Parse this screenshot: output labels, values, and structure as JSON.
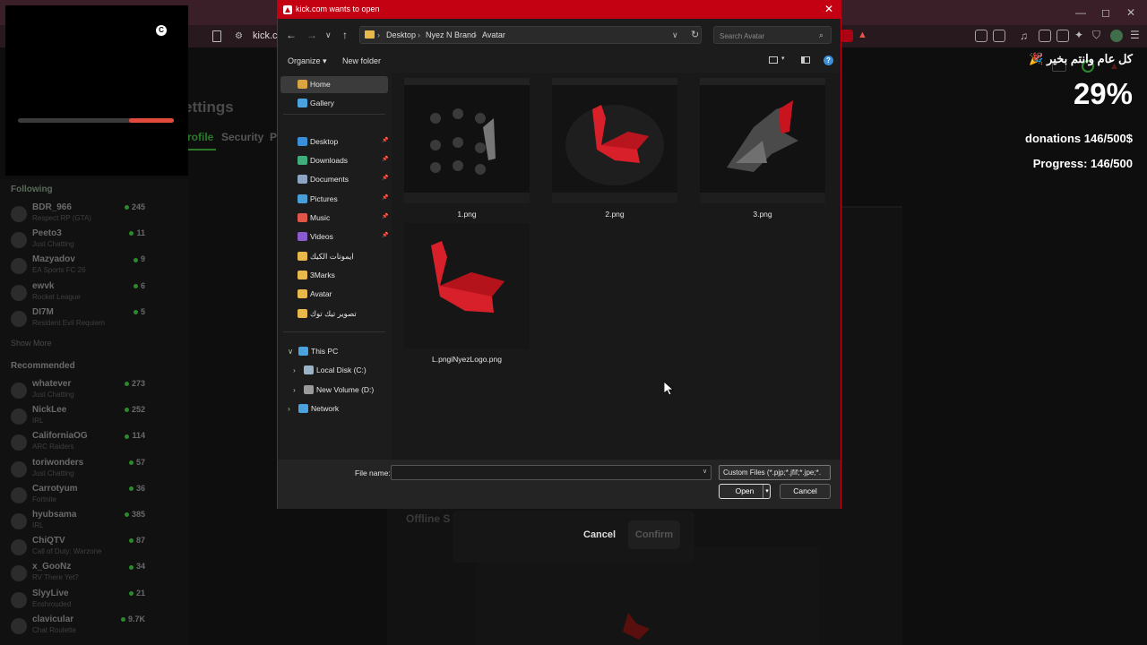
{
  "browser": {
    "url": "kick.cc",
    "window_controls": [
      "—",
      "◻",
      "✕"
    ]
  },
  "overlay": {
    "heading": "كل عام وانتم بخير 🎉",
    "percent": "29%",
    "progress_fraction": 0.29,
    "donations": "donations 146/500$",
    "progress": "Progress: 146/500"
  },
  "kick": {
    "page_title": "ettings",
    "tabs": [
      "rofile",
      "Security",
      "P"
    ],
    "following_title": "Following",
    "following": [
      {
        "name": "BDR_966",
        "game": "Respect RP (GTA)",
        "viewers": "245"
      },
      {
        "name": "Peeto3",
        "game": "Just Chatting",
        "viewers": "11"
      },
      {
        "name": "Mazyadov",
        "game": "EA Sports FC 26",
        "viewers": "9"
      },
      {
        "name": "ewvk",
        "game": "Rocket League",
        "viewers": "6"
      },
      {
        "name": "DI7M",
        "game": "Resident Evil Requiem",
        "viewers": "5"
      }
    ],
    "show_more": "Show More",
    "recommended_title": "Recommended",
    "recommended": [
      {
        "name": "whatever",
        "game": "Just Chatting",
        "viewers": "273"
      },
      {
        "name": "NickLee",
        "game": "IRL",
        "viewers": "252"
      },
      {
        "name": "CaliforniaOG",
        "game": "ARC Raiders",
        "viewers": "114"
      },
      {
        "name": "toriwonders",
        "game": "Just Chatting",
        "viewers": "57"
      },
      {
        "name": "Carrotyum",
        "game": "Fortnite",
        "viewers": "36"
      },
      {
        "name": "hyubsama",
        "game": "IRL",
        "viewers": "385"
      },
      {
        "name": "ChiQTV",
        "game": "Call of Duty: Warzone",
        "viewers": "87"
      },
      {
        "name": "x_GooNz",
        "game": "RV There Yet?",
        "viewers": "34"
      },
      {
        "name": "SlyyLive",
        "game": "Enshrouded",
        "viewers": "21"
      },
      {
        "name": "clavicular",
        "game": "Chat Roulette",
        "viewers": "9.7K"
      }
    ],
    "offline_label": "Offline S",
    "cancel": "Cancel",
    "confirm": "Confirm"
  },
  "dialog": {
    "title": "kick.com wants to open",
    "close": "✕",
    "breadcrumb": [
      "Desktop",
      "Nyez N Brand",
      "Avatar"
    ],
    "search_placeholder": "Search Avatar",
    "organize": "Organize ▾",
    "new_folder": "New folder",
    "nav_items": [
      {
        "label": "Home",
        "icon": "home-icon",
        "color": "#d9a441",
        "selected": true,
        "pin": false
      },
      {
        "label": "Gallery",
        "icon": "gallery-icon",
        "color": "#4aa3df",
        "selected": false,
        "pin": false
      },
      {
        "label": "Desktop",
        "icon": "desktop-icon",
        "color": "#3a8fd8",
        "selected": false,
        "pin": true
      },
      {
        "label": "Downloads",
        "icon": "downloads-icon",
        "color": "#3fae7a",
        "selected": false,
        "pin": true
      },
      {
        "label": "Documents",
        "icon": "documents-icon",
        "color": "#8da4c2",
        "selected": false,
        "pin": true
      },
      {
        "label": "Pictures",
        "icon": "pictures-icon",
        "color": "#4a9ed8",
        "selected": false,
        "pin": true
      },
      {
        "label": "Music",
        "icon": "music-icon",
        "color": "#e0574a",
        "selected": false,
        "pin": true
      },
      {
        "label": "Videos",
        "icon": "videos-icon",
        "color": "#8a5bd0",
        "selected": false,
        "pin": true
      },
      {
        "label": "ايموتات الكيك",
        "icon": "folder-icon",
        "color": "#e8b84a",
        "selected": false,
        "pin": false
      },
      {
        "label": "3Marks",
        "icon": "folder-icon",
        "color": "#e8b84a",
        "selected": false,
        "pin": false
      },
      {
        "label": "Avatar",
        "icon": "folder-icon",
        "color": "#e8b84a",
        "selected": false,
        "pin": false
      },
      {
        "label": "تصوير تيك توك",
        "icon": "folder-icon",
        "color": "#e8b84a",
        "selected": false,
        "pin": false
      }
    ],
    "tree": [
      {
        "label": "This PC",
        "icon": "pc-icon",
        "color": "#4aa3df",
        "arrow": "∨"
      },
      {
        "label": "Local Disk (C:)",
        "icon": "disk-icon",
        "color": "#9bb3c9",
        "arrow": "›"
      },
      {
        "label": "New Volume (D:)",
        "icon": "drive-icon",
        "color": "#9a9a9a",
        "arrow": "›"
      },
      {
        "label": "Network",
        "icon": "network-icon",
        "color": "#4aa3df",
        "arrow": "›"
      }
    ],
    "files": [
      {
        "name": "1.png",
        "kind": "dark-emotes"
      },
      {
        "name": "2.png",
        "kind": "red-swan"
      },
      {
        "name": "3.png",
        "kind": "dark-bird"
      },
      {
        "name": "L.pngiNyezLogo.png",
        "kind": "red-swan-large"
      }
    ],
    "file_name_label": "File name:",
    "file_name_value": "",
    "filter": "Custom Files (*.pjp;*.jfif;*.jpe;*.",
    "open": "Open",
    "cancel": "Cancel"
  },
  "colors": {
    "accent_red": "#c40013",
    "kick_green": "#53fc18"
  }
}
